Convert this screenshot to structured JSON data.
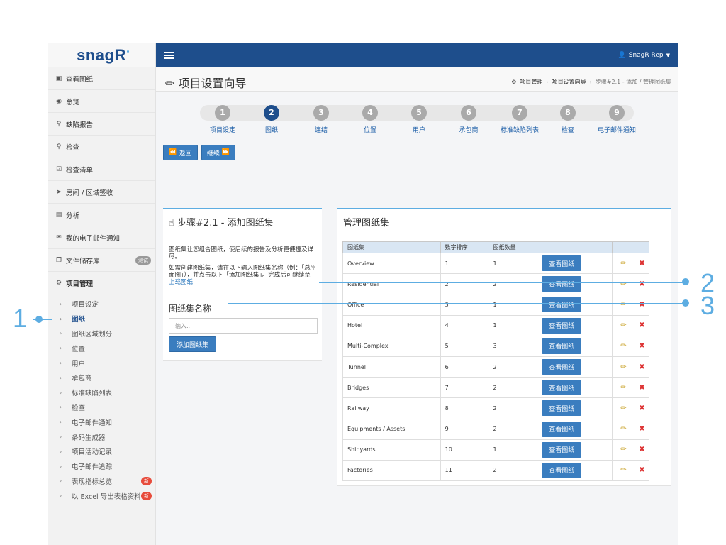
{
  "logo": "snagR",
  "sidebar": {
    "items": [
      {
        "icon": "image-icon",
        "label": "查看图纸"
      },
      {
        "icon": "dashboard-icon",
        "label": "总览"
      },
      {
        "icon": "map-marker-icon",
        "label": "缺陷报告"
      },
      {
        "icon": "search-icon",
        "label": "检查"
      },
      {
        "icon": "checklist-icon",
        "label": "检查清单"
      },
      {
        "icon": "send-icon",
        "label": "房间 / 区域签收"
      },
      {
        "icon": "bar-chart-icon",
        "label": "分析"
      },
      {
        "icon": "envelope-icon",
        "label": "我的电子邮件通知"
      },
      {
        "icon": "copy-icon",
        "label": "文件储存库",
        "badge": "测试"
      },
      {
        "icon": "cogs-icon",
        "label": "项目管理"
      }
    ],
    "subitems": [
      {
        "label": "项目设定"
      },
      {
        "label": "图纸",
        "active": true
      },
      {
        "label": "图纸区域划分"
      },
      {
        "label": "位置"
      },
      {
        "label": "用户"
      },
      {
        "label": "承包商"
      },
      {
        "label": "标准缺陷列表"
      },
      {
        "label": "检查"
      },
      {
        "label": "电子邮件通知"
      },
      {
        "label": "条码生成器"
      },
      {
        "label": "项目活动记录"
      },
      {
        "label": "电子邮件追踪"
      },
      {
        "label": "表现指标总览",
        "badge": "新"
      },
      {
        "label": "以 Excel 导出表格资料",
        "badge": "新"
      }
    ]
  },
  "topbar": {
    "user": "SnagR Rep"
  },
  "page": {
    "title": "项目设置向导",
    "breadcrumb": [
      "项目管理",
      "项目设置向导",
      "步骤#2.1 - 添加 / 管理图纸集"
    ]
  },
  "steps": [
    {
      "num": "1",
      "label": "项目设定"
    },
    {
      "num": "2",
      "label": "图纸",
      "active": true
    },
    {
      "num": "3",
      "label": "连结"
    },
    {
      "num": "4",
      "label": "位置"
    },
    {
      "num": "5",
      "label": "用户"
    },
    {
      "num": "6",
      "label": "承包商"
    },
    {
      "num": "7",
      "label": "标准缺陷列表"
    },
    {
      "num": "8",
      "label": "检查"
    },
    {
      "num": "9",
      "label": "电子邮件通知"
    }
  ],
  "nav_buttons": {
    "back": "返回",
    "next": "继续"
  },
  "step_panel": {
    "title": "步骤#2.1 - 添加图纸集",
    "desc1": "图纸集让您组合图纸，使后续的报告及分析更便捷及详尽。",
    "desc2": "如需创建图纸集，请在以下输入图纸集名称（例：「总平面图」），并点击以下「添加图纸集」。完成后可继续至",
    "link": "上载图纸",
    "field_label": "图纸集名称",
    "placeholder": "输入...",
    "add_button": "添加图纸集"
  },
  "manage_panel": {
    "title": "管理图纸集",
    "columns": [
      "图纸集",
      "数字排序",
      "图纸数量"
    ],
    "view_label": "查看图纸",
    "rows": [
      {
        "name": "Overview",
        "order": "1",
        "count": "1"
      },
      {
        "name": "Residential",
        "order": "2",
        "count": "2"
      },
      {
        "name": "Office",
        "order": "3",
        "count": "1"
      },
      {
        "name": "Hotel",
        "order": "4",
        "count": "1"
      },
      {
        "name": "Multi-Complex",
        "order": "5",
        "count": "3"
      },
      {
        "name": "Tunnel",
        "order": "6",
        "count": "2"
      },
      {
        "name": "Bridges",
        "order": "7",
        "count": "2"
      },
      {
        "name": "Railway",
        "order": "8",
        "count": "2"
      },
      {
        "name": "Equipments / Assets",
        "order": "9",
        "count": "2"
      },
      {
        "name": "Shipyards",
        "order": "10",
        "count": "1"
      },
      {
        "name": "Factories",
        "order": "11",
        "count": "2"
      }
    ]
  },
  "callouts": [
    "1",
    "2",
    "3"
  ]
}
